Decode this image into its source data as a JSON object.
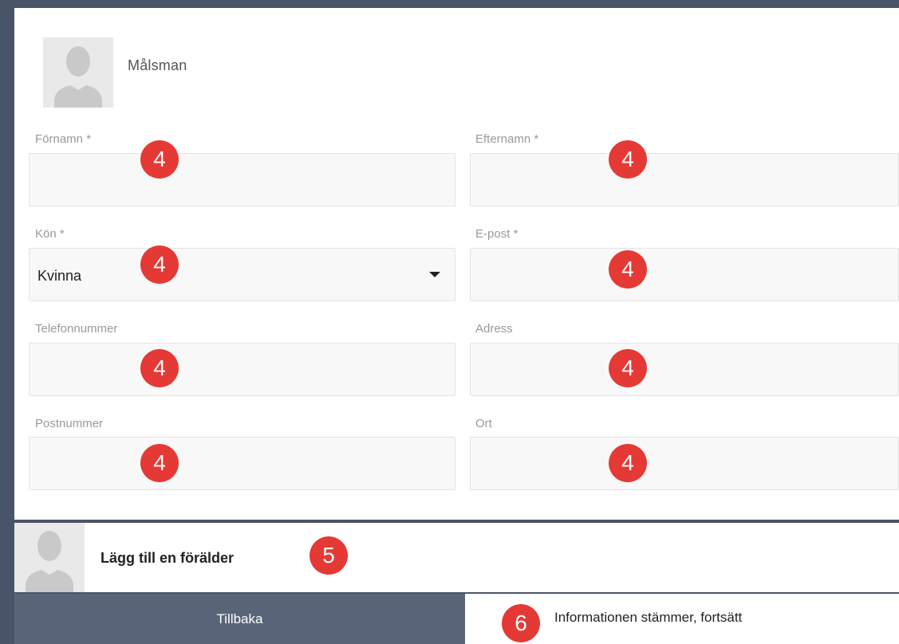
{
  "guardian": {
    "title": "Målsman",
    "avatar_icon": "person-silhouette-icon"
  },
  "form": {
    "first_name": {
      "label": "Förnamn *",
      "value": "",
      "badge": "4"
    },
    "last_name": {
      "label": "Efternamn *",
      "value": "",
      "badge": "4"
    },
    "gender": {
      "label": "Kön *",
      "value": "Kvinna",
      "badge": "4"
    },
    "email": {
      "label": "E-post *",
      "value": "",
      "badge": "4"
    },
    "phone": {
      "label": "Telefonnummer",
      "value": "",
      "badge": "4"
    },
    "address": {
      "label": "Adress",
      "value": "",
      "badge": "4"
    },
    "postal_code": {
      "label": "Postnummer",
      "value": "",
      "badge": "4"
    },
    "city": {
      "label": "Ort",
      "value": "",
      "badge": "4"
    }
  },
  "add_parent": {
    "label": "Lägg till en förälder",
    "badge": "5"
  },
  "footer": {
    "back_label": "Tillbaka",
    "continue_label": "Informationen stämmer, fortsätt",
    "continue_badge": "6"
  },
  "colors": {
    "badge": "#e53935",
    "background": "#4a5468",
    "back_button": "#5a6479"
  }
}
